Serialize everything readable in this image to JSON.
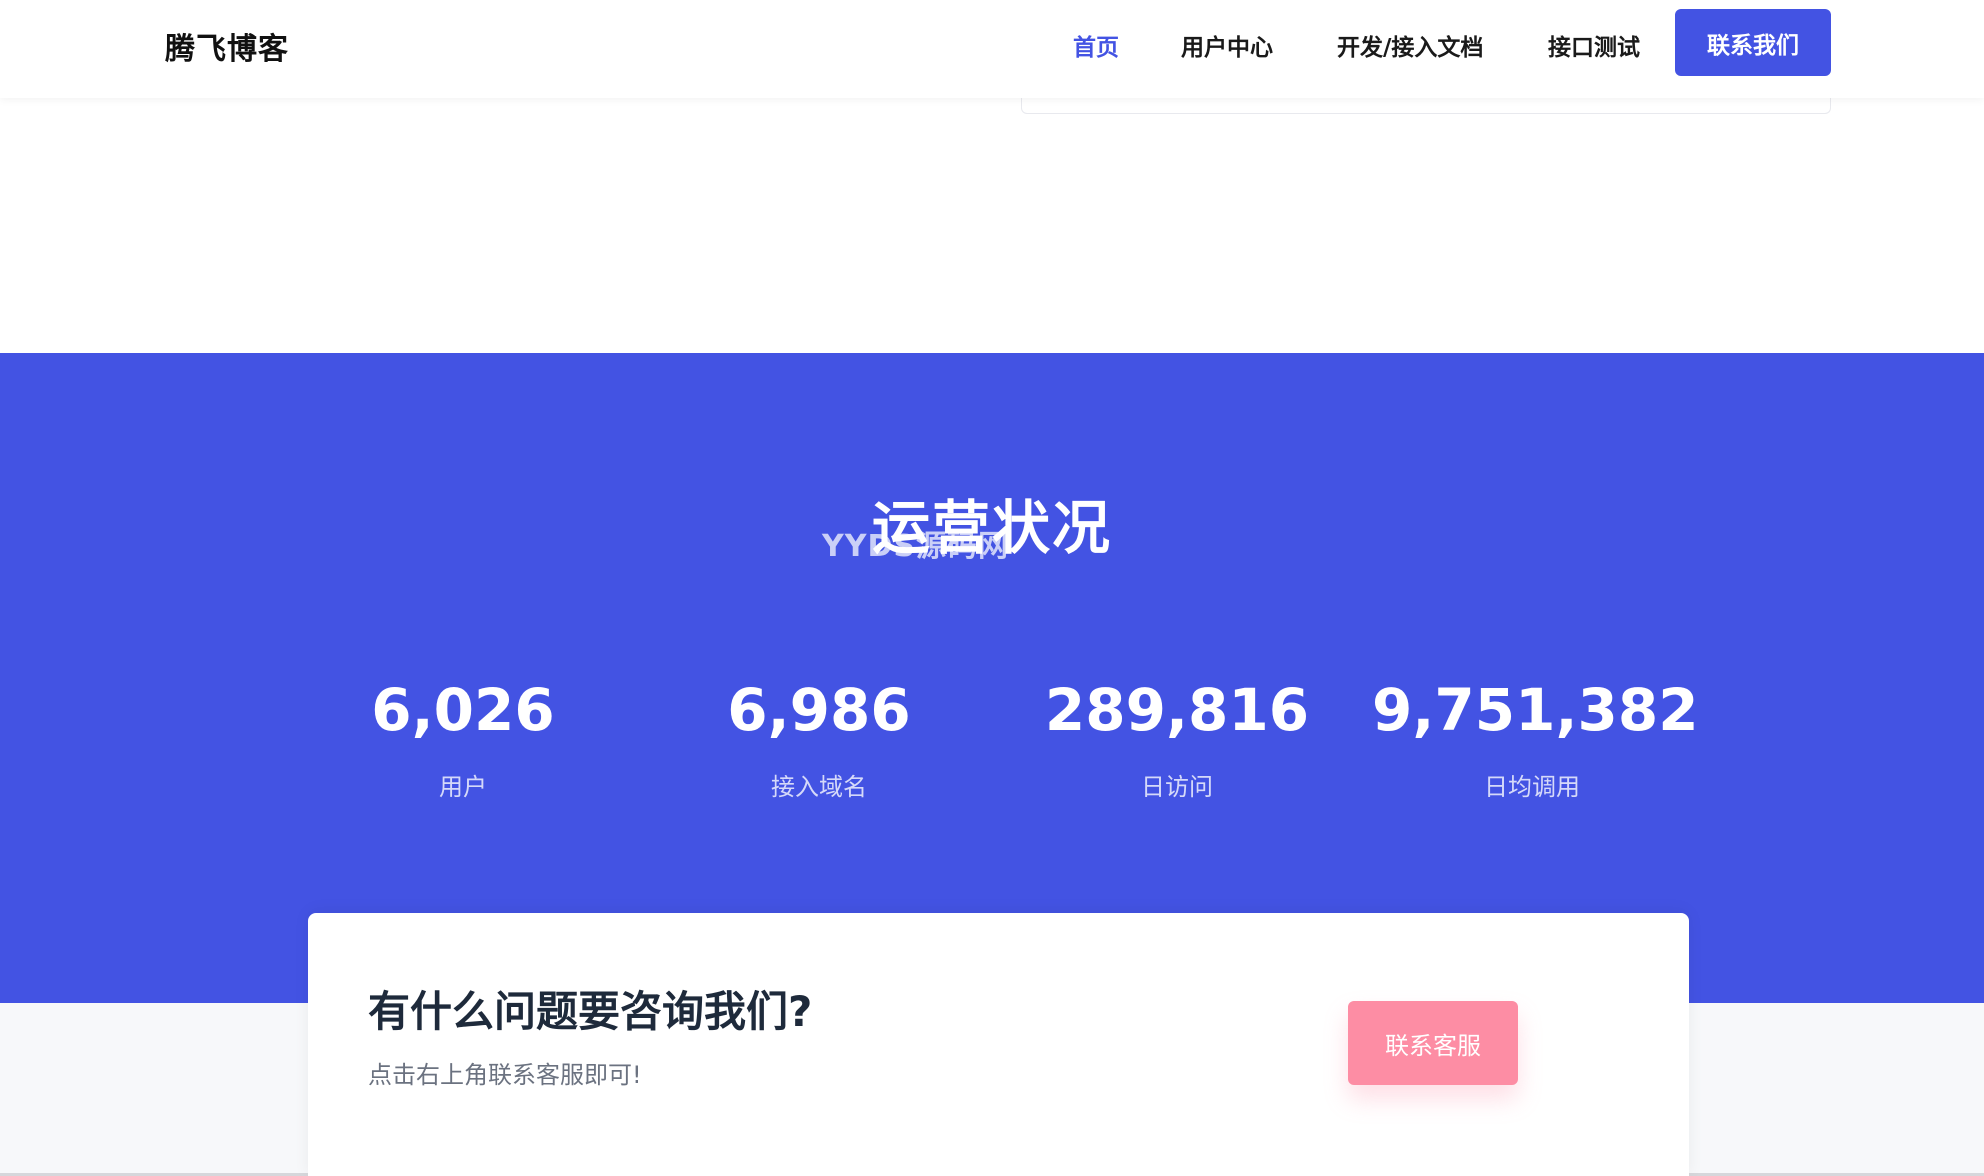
{
  "header": {
    "brand": "腾飞博客",
    "nav": [
      {
        "label": "首页",
        "active": true
      },
      {
        "label": "用户中心",
        "active": false
      },
      {
        "label": "开发/接入文档",
        "active": false
      },
      {
        "label": "接口测试",
        "active": false
      }
    ],
    "contact_label": "联系我们"
  },
  "stats": {
    "title": "运营状况",
    "watermark": "YYDS源码网",
    "items": [
      {
        "value": "6,026",
        "label": "用户"
      },
      {
        "value": "6,986",
        "label": "接入域名"
      },
      {
        "value": "289,816",
        "label": "日访问"
      },
      {
        "value": "9,751,382",
        "label": "日均调用"
      }
    ]
  },
  "cta": {
    "title": "有什么问题要咨询我们?",
    "subtitle": "点击右上角联系客服即可!",
    "button_label": "联系客服"
  },
  "colors": {
    "primary": "#4353e3",
    "cta_button": "#fd8da4",
    "heading_dark": "#1e2a3b"
  }
}
